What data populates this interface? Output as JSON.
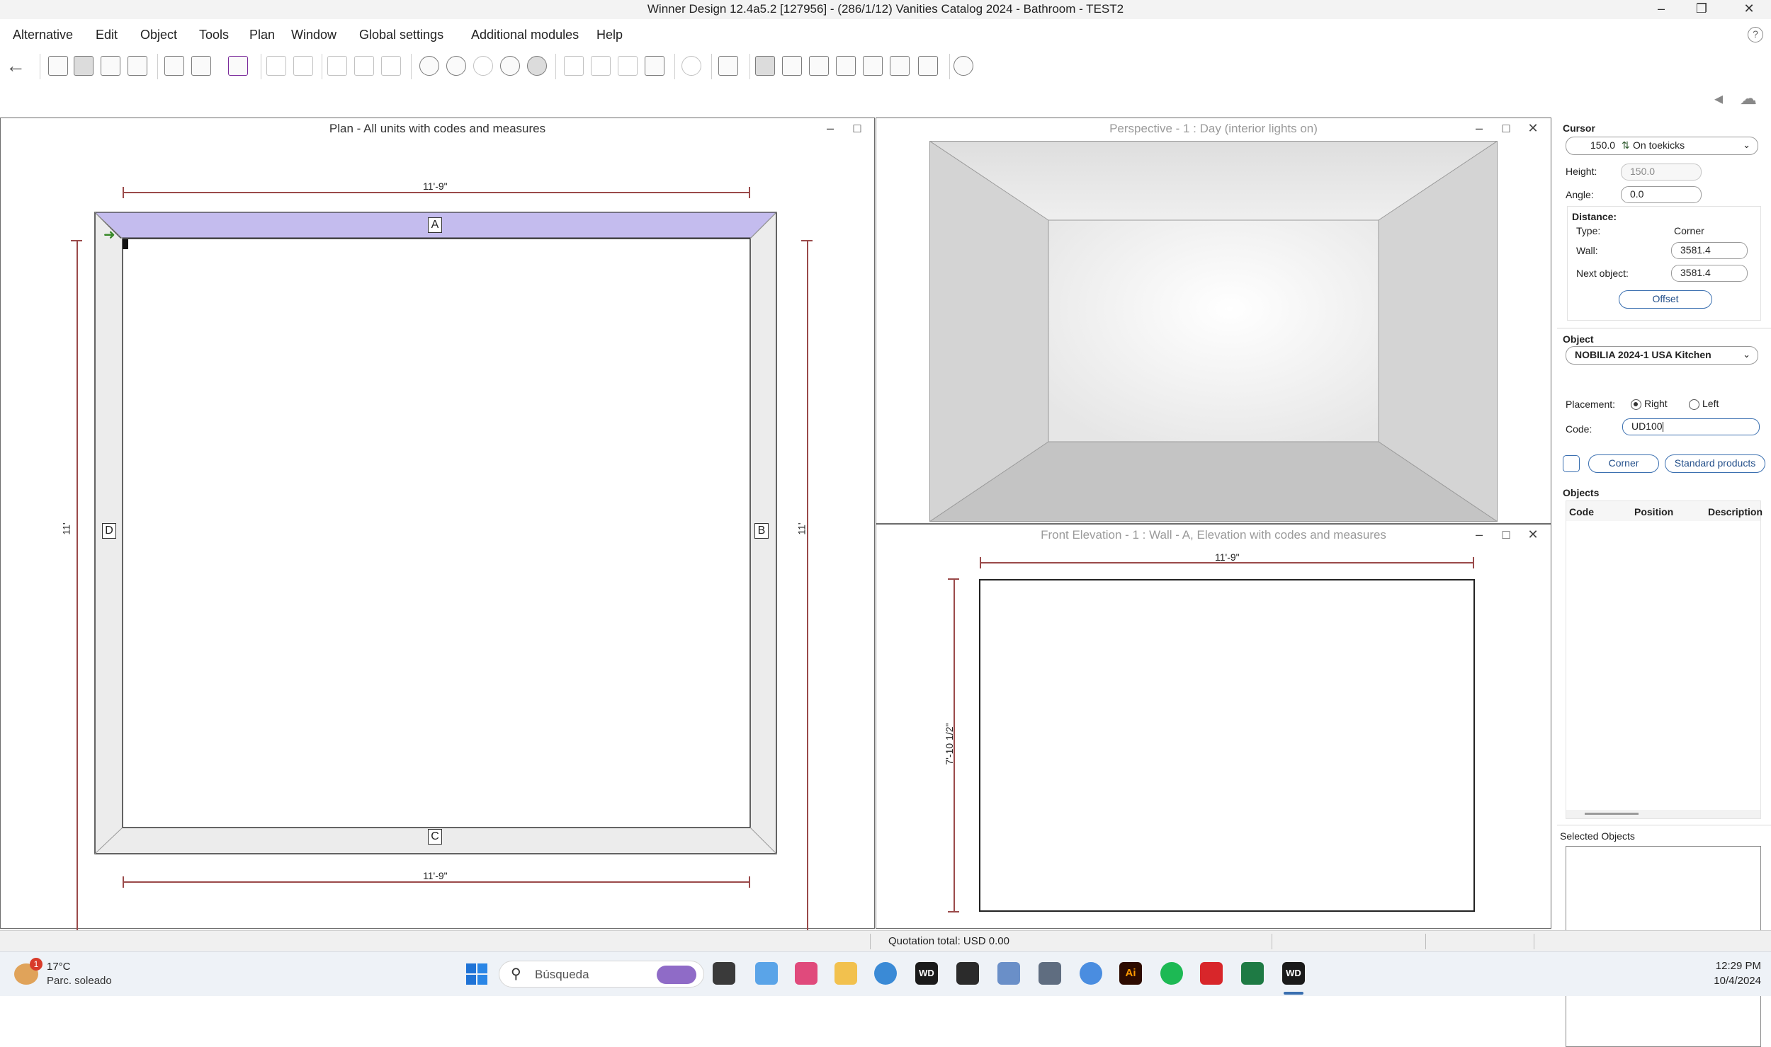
{
  "window": {
    "title": "Winner Design 12.4a5.2  [127956]  - (286/1/12) Vanities Catalog 2024 - Bathroom - TEST2",
    "minimize": "–",
    "maximize": "❐",
    "close": "✕"
  },
  "menu": [
    "Alternative",
    "Edit",
    "Object",
    "Tools",
    "Plan",
    "Window",
    "Global settings",
    "Additional modules",
    "Help"
  ],
  "help_glyph": "?",
  "plan_panel": {
    "title": "Plan - All units with codes and measures",
    "dim_top": "11'-9\"",
    "dim_bottom": "11'-9\"",
    "dim_left": "11'",
    "dim_right": "11'",
    "walls": {
      "a": "A",
      "b": "B",
      "c": "C",
      "d": "D"
    },
    "wall_color": "#c4bcee",
    "wall_gray": "#ececec"
  },
  "perspective_panel": {
    "title": "Perspective - 1 : Day (interior lights on)"
  },
  "elevation_panel": {
    "title": "Front Elevation - 1 : Wall - A, Elevation with codes and measures",
    "dim_top": "11'-9\"",
    "dim_left": "7'-10 1/2\""
  },
  "sidebar": {
    "cursor_heading": "Cursor",
    "cursor_value": "150.0",
    "cursor_mode": "On toekicks",
    "height_label": "Height:",
    "height_value": "150.0",
    "angle_label": "Angle:",
    "angle_value": "0.0",
    "distance_heading": "Distance:",
    "type_label": "Type:",
    "type_value": "Corner",
    "wall_label": "Wall:",
    "wall_value": "3581.4",
    "next_label": "Next object:",
    "next_value": "3581.4",
    "offset_button": "Offset",
    "object_heading": "Object",
    "catalog": "NOBILIA 2024-1 USA Kitchen",
    "placement_label": "Placement:",
    "placement_right": "Right",
    "placement_left": "Left",
    "placement_selected": "Right",
    "code_label": "Code:",
    "code_value": "UD100",
    "corner_button": "Corner",
    "standard_button": "Standard products",
    "objects_heading": "Objects",
    "objects_columns": [
      "Code",
      "Position",
      "Description"
    ],
    "selected_heading": "Selected Objects"
  },
  "status": {
    "quotation": "Quotation total: USD 0.00"
  },
  "taskbar": {
    "weather_temp": "17°C",
    "weather_desc": "Parc. soleado",
    "weather_badge": "1",
    "search_placeholder": "Búsqueda",
    "time": "12:29 PM",
    "date": "10/4/2024",
    "wd_label": "WD"
  }
}
